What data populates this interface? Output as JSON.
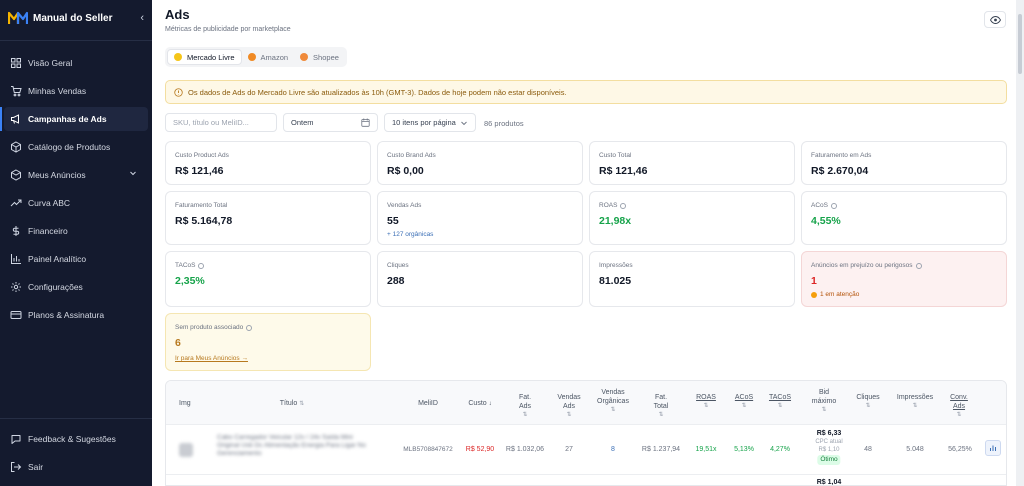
{
  "sidebar": {
    "brand": "Manual do Seller",
    "items": [
      {
        "label": "Visão Geral",
        "icon": "grid-icon"
      },
      {
        "label": "Minhas Vendas",
        "icon": "cart-icon"
      },
      {
        "label": "Campanhas de Ads",
        "icon": "megaphone-icon"
      },
      {
        "label": "Catálogo de Produtos",
        "icon": "box-icon"
      },
      {
        "label": "Meus Anúncios",
        "icon": "cube-icon"
      },
      {
        "label": "Curva ABC",
        "icon": "trend-icon"
      },
      {
        "label": "Financeiro",
        "icon": "dollar-icon"
      },
      {
        "label": "Painel Analítico",
        "icon": "bar-chart-icon"
      },
      {
        "label": "Configurações",
        "icon": "gear-icon"
      },
      {
        "label": "Planos & Assinatura",
        "icon": "card-icon"
      }
    ],
    "active_index": 2,
    "feedback": "Feedback & Sugestões",
    "logout": "Sair"
  },
  "header": {
    "title": "Ads",
    "subtitle": "Métricas de publicidade por marketplace"
  },
  "marketplaces": [
    {
      "label": "Mercado Livre",
      "color": "#f5c518",
      "active": true
    },
    {
      "label": "Amazon",
      "color": "#f08a24",
      "active": false
    },
    {
      "label": "Shopee",
      "color": "#f08a3a",
      "active": false
    }
  ],
  "alert": {
    "text": "Os dados de Ads do Mercado Livre são atualizados às 10h (GMT-3). Dados de hoje podem não estar disponíveis."
  },
  "filters": {
    "search_placeholder": "SKU, título ou MeliID...",
    "date": "Ontem",
    "per_page": "10 itens por página",
    "count": "86 produtos"
  },
  "metrics": {
    "custo_product": {
      "label": "Custo Product Ads",
      "value": "R$ 121,46"
    },
    "custo_brand": {
      "label": "Custo Brand Ads",
      "value": "R$ 0,00"
    },
    "custo_total": {
      "label": "Custo Total",
      "value": "R$ 121,46"
    },
    "fat_ads": {
      "label": "Faturamento em Ads",
      "value": "R$ 2.670,04"
    },
    "fat_total": {
      "label": "Faturamento Total",
      "value": "R$ 5.164,78"
    },
    "vendas_ads": {
      "label": "Vendas Ads",
      "value": "55",
      "sub": "+ 127 orgânicas"
    },
    "roas": {
      "label": "ROAS",
      "value": "21,98x"
    },
    "acos": {
      "label": "ACoS",
      "value": "4,55%"
    },
    "tacos": {
      "label": "TACoS",
      "value": "2,35%"
    },
    "cliques": {
      "label": "Cliques",
      "value": "288"
    },
    "impressoes": {
      "label": "Impressões",
      "value": "81.025"
    },
    "prejuizo": {
      "label": "Anúncios em prejuízo ou perigosos",
      "value": "1",
      "sub": "1 em atenção"
    },
    "sem_produto": {
      "label": "Sem produto associado",
      "value": "6",
      "link": "Ir para Meus Anúncios →"
    }
  },
  "table": {
    "headers": {
      "img": "Img",
      "titulo": "Título",
      "meliid": "MeliID",
      "custo": "Custo",
      "fat_ads": "Fat. Ads",
      "vendas_ads": "Vendas Ads",
      "vendas_org": "Vendas Orgânicas",
      "fat_total": "Fat. Total",
      "roas": "ROAS",
      "acos": "ACoS",
      "tacos": "TACoS",
      "bid": "Bid máximo",
      "cliques": "Cliques",
      "impressoes": "Impressões",
      "conv": "Conv. Ads"
    },
    "rows": [
      {
        "titulo": "Cabo Carregador Veicular 12v / 24v Saída Mini Original Usb Dc Alimentação Energia Para Ligar No Gerenciamento",
        "meliid": "MLB5708847672",
        "custo": "R$ 52,90",
        "fat_ads": "R$ 1.032,06",
        "vendas_ads": "27",
        "vendas_org": "8",
        "fat_total": "R$ 1.237,94",
        "roas": "19,51x",
        "acos": "5,13%",
        "tacos": "4,27%",
        "bid": "R$ 6,33",
        "bid_note": "CPC atual",
        "bid_cpc": "R$ 1,10",
        "bid_badge": "Ótimo",
        "cliques": "48",
        "impressoes": "5.048",
        "conv": "56,25%"
      },
      {
        "bid": "R$ 1,04"
      }
    ]
  }
}
